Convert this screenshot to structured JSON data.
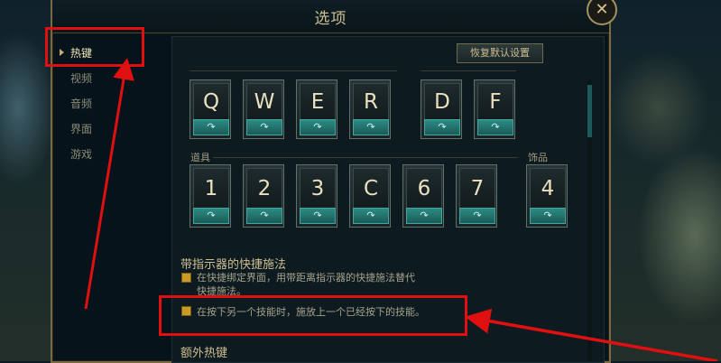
{
  "window": {
    "title": "选项",
    "close_label": "✕"
  },
  "sidebar": {
    "items": [
      {
        "label": "热键",
        "active": true
      },
      {
        "label": "视频"
      },
      {
        "label": "音频"
      },
      {
        "label": "界面"
      },
      {
        "label": "游戏"
      }
    ]
  },
  "toolbar": {
    "reset_label": "恢复默认设置"
  },
  "hotkeys": {
    "row1": [
      {
        "key": "Q",
        "sub": "↷"
      },
      {
        "key": "W",
        "sub": "↷"
      },
      {
        "key": "E",
        "sub": "↷"
      },
      {
        "key": "R",
        "sub": "↷"
      },
      {
        "key": "D",
        "sub": "↷"
      },
      {
        "key": "F",
        "sub": "↷"
      }
    ],
    "items_label": "道具",
    "trinket_label": "饰品",
    "row2": [
      {
        "key": "1",
        "sub": "↷"
      },
      {
        "key": "2",
        "sub": "↷"
      },
      {
        "key": "3",
        "sub": "↷"
      },
      {
        "key": "C",
        "sub": "↷"
      },
      {
        "key": "6",
        "sub": "↷"
      },
      {
        "key": "7",
        "sub": "↷"
      }
    ],
    "trinket": {
      "key": "4",
      "sub": "↷"
    }
  },
  "quickcast": {
    "title": "带指示器的快捷施法",
    "option1_line1": "在快捷绑定界面，用带距离指示器的快捷施法替代",
    "option1_line2": "快捷施法。",
    "option2": "在按下另一个技能时，施放上一个已经按下的技能。"
  },
  "extra_title": "额外热键",
  "colors": {
    "accent": "#cdbe91",
    "annotation": "#e01010",
    "checkbox": "#c89b27"
  }
}
